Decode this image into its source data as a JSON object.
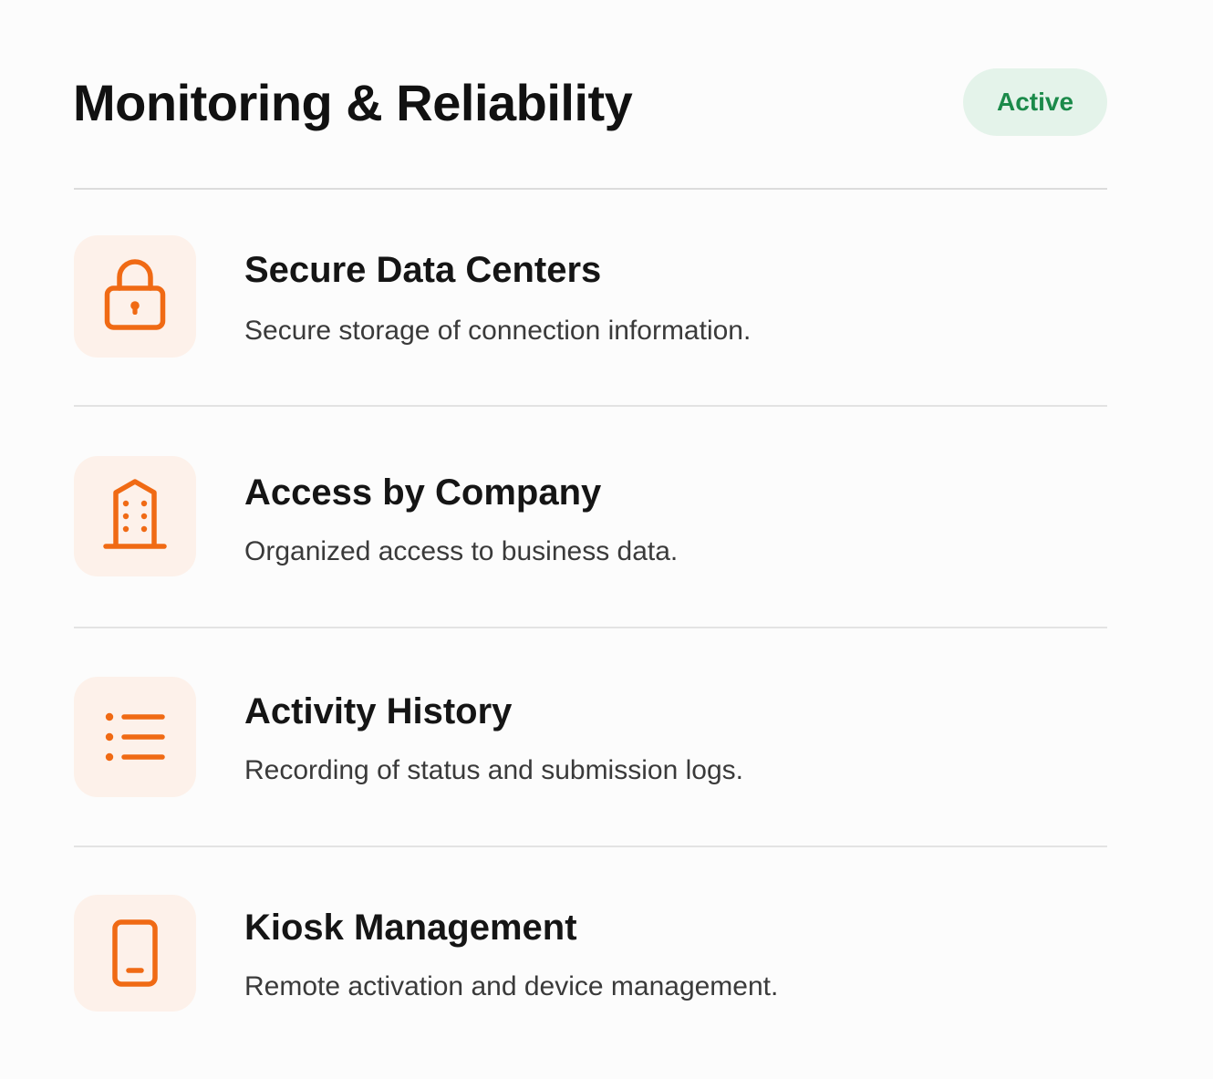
{
  "header": {
    "title": "Monitoring & Reliability",
    "status_badge": "Active"
  },
  "colors": {
    "accent": "#f06a14",
    "icon_background": "#fdf1ea",
    "badge_background": "#e4f3ea",
    "badge_text": "#1b8a4a"
  },
  "features": [
    {
      "icon": "lock-icon",
      "title": "Secure Data Centers",
      "description": "Secure storage of connection information."
    },
    {
      "icon": "building-icon",
      "title": "Access by Company",
      "description": "Organized access to business data."
    },
    {
      "icon": "list-icon",
      "title": "Activity History",
      "description": "Recording of status and submission logs."
    },
    {
      "icon": "smartphone-icon",
      "title": "Kiosk Management",
      "description": "Remote activation and device management."
    }
  ]
}
